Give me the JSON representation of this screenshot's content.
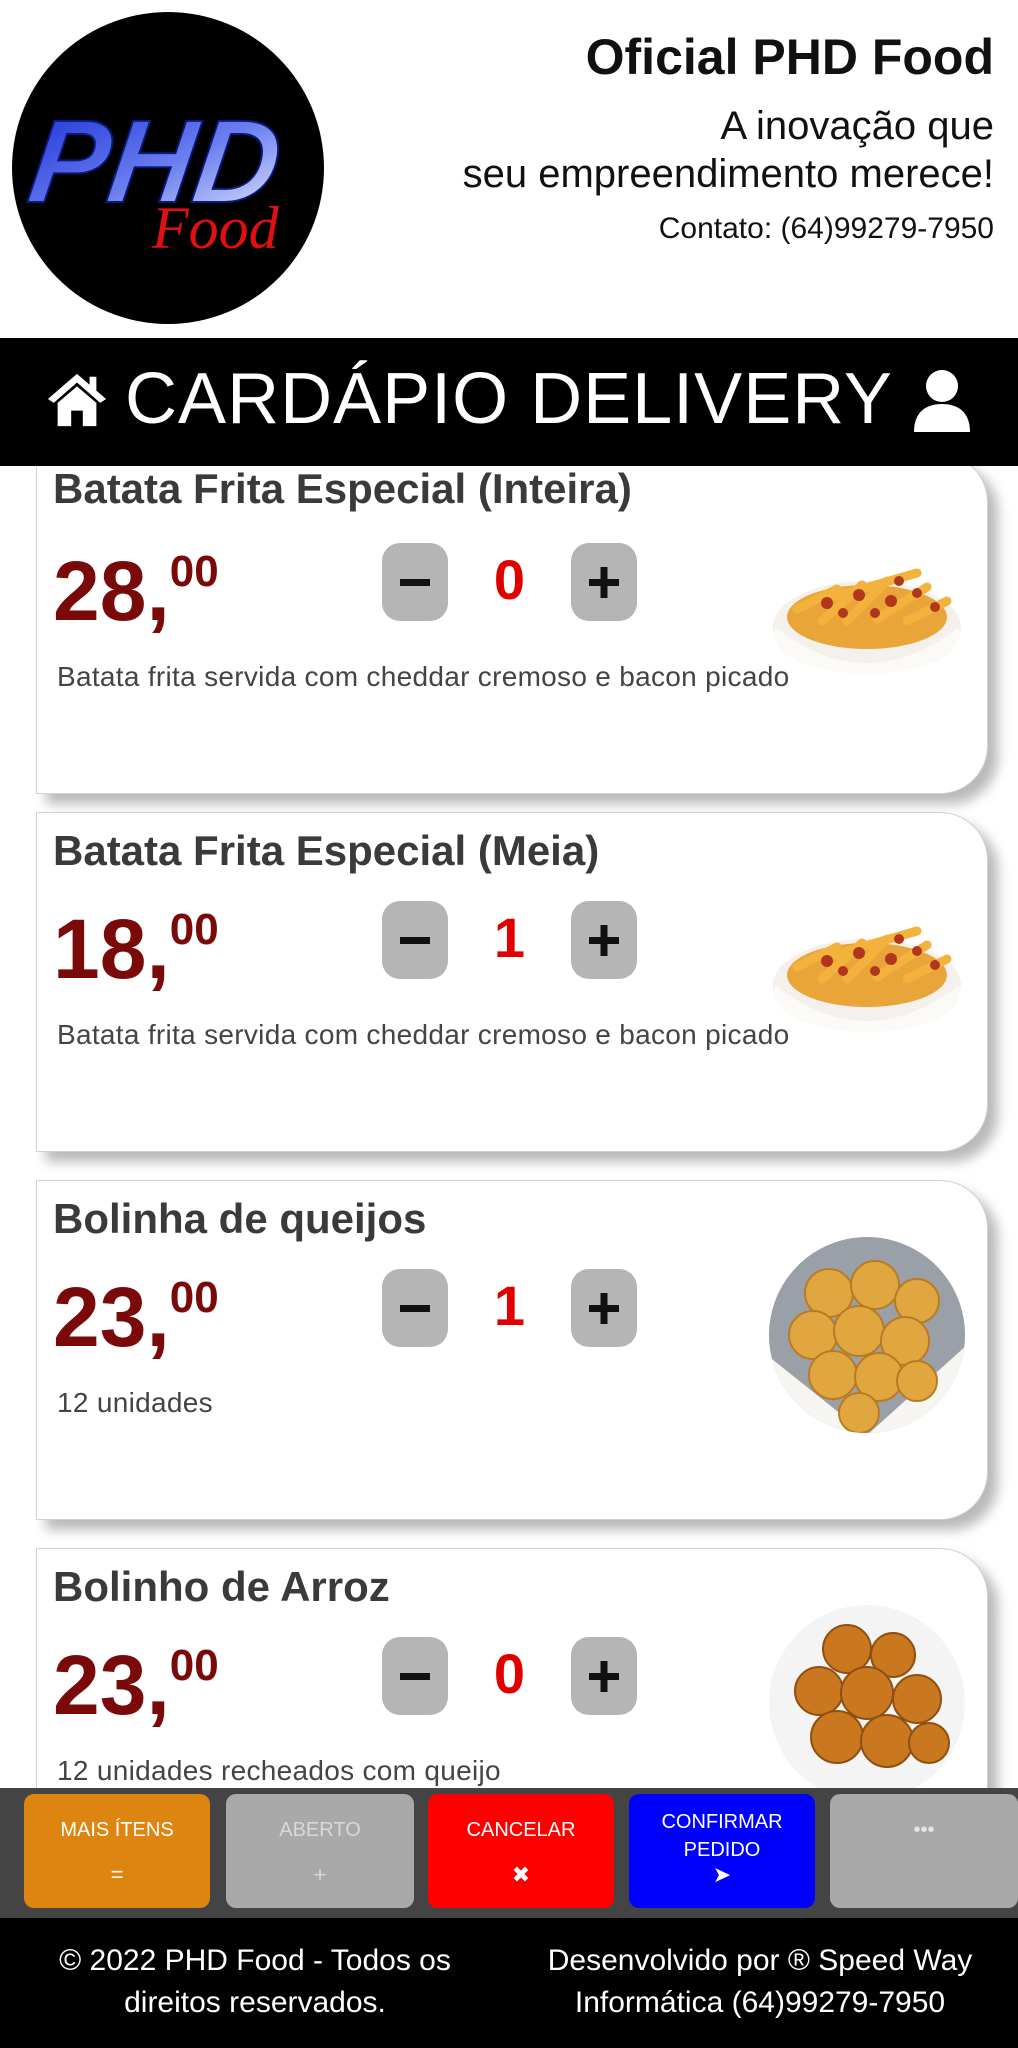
{
  "header": {
    "brand_title": "Oficial PHD Food",
    "tagline_line1": "A inovação que",
    "tagline_line2": "seu empreendimento merece!",
    "contact": "Contato: (64)99279-7950",
    "logo_text_main": "PHD",
    "logo_text_sub": "Food"
  },
  "nav": {
    "title": "CARDÁPIO DELIVERY",
    "home_icon": "home-icon",
    "user_icon": "user-icon"
  },
  "products": [
    {
      "name": "Batata Frita Especial (Inteira)",
      "price_int": "28",
      "price_dec": "00",
      "qty": "0",
      "description": "Batata frita servida com cheddar cremoso e bacon picado",
      "image": "fries-dish-image"
    },
    {
      "name": "Batata Frita Especial (Meia)",
      "price_int": "18",
      "price_dec": "00",
      "qty": "1",
      "description": "Batata frita servida com cheddar cremoso e bacon picado",
      "image": "fries-dish-image"
    },
    {
      "name": "Bolinha de queijos",
      "price_int": "23",
      "price_dec": "00",
      "qty": "1",
      "description": "12 unidades",
      "image": "cheese-balls-image"
    },
    {
      "name": "Bolinho de Arroz",
      "price_int": "23",
      "price_dec": "00",
      "qty": "0",
      "description": "12 unidades recheados com queijo",
      "image": "rice-balls-image"
    }
  ],
  "actions": {
    "more_items": {
      "label": "MAIS ÍTENS",
      "icon": "="
    },
    "open": {
      "label": "ABERTO",
      "icon": "+"
    },
    "cancel": {
      "label": "CANCELAR",
      "icon": "✖"
    },
    "confirm": {
      "label_line1": "CONFIRMAR",
      "label_line2": "PEDIDO",
      "icon": "➤"
    },
    "extra": {
      "label": "•••"
    }
  },
  "footer": {
    "left_line1": "© 2022 PHD Food - Todos os",
    "left_line2": "direitos reservados.",
    "right_line1": "Desenvolvido por ® Speed Way",
    "right_line2": "Informática (64)99279-7950"
  },
  "colors": {
    "price": "#7a0a0a",
    "qty": "#e00000",
    "more_items": "#de8511",
    "cancel": "#ff0000",
    "confirm": "#0000ff",
    "disabled": "#a9a9a9"
  }
}
